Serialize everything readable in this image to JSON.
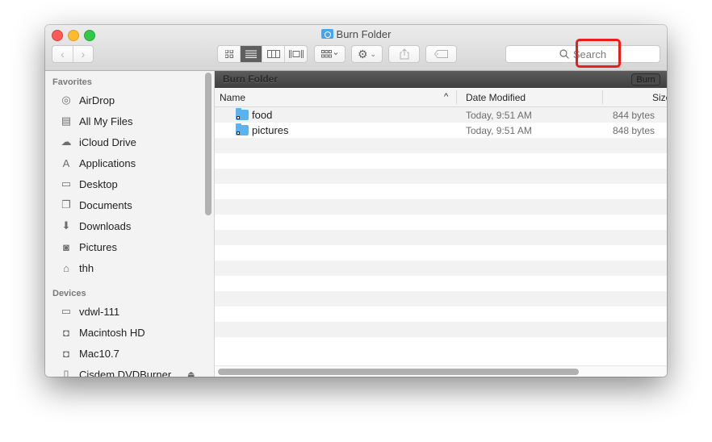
{
  "window": {
    "title": "Burn Folder",
    "title_icon": "burn-folder-icon"
  },
  "toolbar": {
    "back_icon": "chevron-left",
    "forward_icon": "chevron-right",
    "view_modes": [
      {
        "name": "icon-view",
        "glyph": "▫▫",
        "active": false
      },
      {
        "name": "list-view",
        "glyph": "☰",
        "active": true
      },
      {
        "name": "column-view",
        "glyph": "▥",
        "active": false
      },
      {
        "name": "cover-flow-view",
        "glyph": "|▭|",
        "active": false
      }
    ],
    "arrange_glyph": "▦ ⌄",
    "action_glyph": "⚙ ⌄",
    "share_glyph": "⇪",
    "tag_glyph": "⬭",
    "search_placeholder": "Search"
  },
  "sidebar": {
    "favorites_label": "Favorites",
    "favorites": [
      {
        "label": "AirDrop",
        "icon": "airdrop-icon",
        "glyph": "◎"
      },
      {
        "label": "All My Files",
        "icon": "all-my-files-icon",
        "glyph": "▤"
      },
      {
        "label": "iCloud Drive",
        "icon": "cloud-icon",
        "glyph": "☁"
      },
      {
        "label": "Applications",
        "icon": "applications-icon",
        "glyph": "A"
      },
      {
        "label": "Desktop",
        "icon": "desktop-icon",
        "glyph": "▭"
      },
      {
        "label": "Documents",
        "icon": "documents-icon",
        "glyph": "❐"
      },
      {
        "label": "Downloads",
        "icon": "downloads-icon",
        "glyph": "⬇"
      },
      {
        "label": "Pictures",
        "icon": "camera-icon",
        "glyph": "◙"
      },
      {
        "label": "thh",
        "icon": "home-icon",
        "glyph": "⌂"
      }
    ],
    "devices_label": "Devices",
    "devices": [
      {
        "label": "vdwl-111",
        "icon": "computer-icon",
        "glyph": "▭"
      },
      {
        "label": "Macintosh HD",
        "icon": "hard-drive-icon",
        "glyph": "◘"
      },
      {
        "label": "Mac10.7",
        "icon": "hard-drive-icon",
        "glyph": "◘"
      },
      {
        "label": "Cisdem DVDBurner",
        "icon": "disk-icon",
        "glyph": "▯",
        "eject": "⏏"
      }
    ]
  },
  "content": {
    "path_label": "Burn Folder",
    "burn_button": "Burn",
    "columns": {
      "name": "Name",
      "sort_indicator": "^",
      "date": "Date Modified",
      "size": "Size"
    },
    "files": [
      {
        "name": "food",
        "date": "Today, 9:51 AM",
        "size": "844 bytes"
      },
      {
        "name": "pictures",
        "date": "Today, 9:51 AM",
        "size": "848 bytes"
      }
    ],
    "empty_rows": 14
  },
  "colors": {
    "highlight": "#ea1c1c",
    "folder": "#5cb2ef",
    "active_view": "#5f5f5f"
  }
}
